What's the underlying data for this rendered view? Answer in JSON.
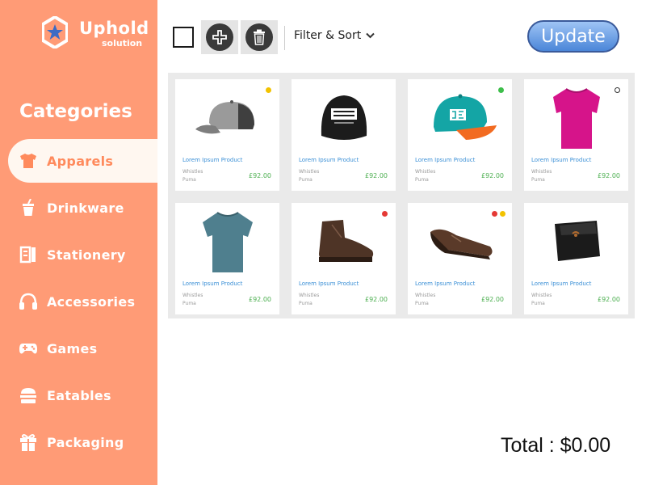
{
  "brand": {
    "name": "Uphold",
    "subtitle": "solution"
  },
  "sidebar": {
    "title": "Categories",
    "items": [
      {
        "label": "Apparels",
        "icon": "tshirt-icon",
        "selected": true
      },
      {
        "label": "Drinkware",
        "icon": "cup-icon"
      },
      {
        "label": "Stationery",
        "icon": "notebook-icon"
      },
      {
        "label": "Accessories",
        "icon": "headphones-icon"
      },
      {
        "label": "Games",
        "icon": "gamepad-icon"
      },
      {
        "label": "Eatables",
        "icon": "burger-icon"
      },
      {
        "label": "Packaging",
        "icon": "gift-icon"
      }
    ]
  },
  "toolbar": {
    "filter_label": "Filter & Sort",
    "update_label": "Update"
  },
  "products": [
    {
      "name": "Lorem Ipsum Product",
      "line1": "Whistles",
      "line2": "Puma",
      "price": "£92.00",
      "image": "grey-cap",
      "badges": [
        "#F2C200"
      ]
    },
    {
      "name": "Lorem Ipsum Product",
      "line1": "Whistles",
      "line2": "Puma",
      "price": "£92.00",
      "image": "black-cap",
      "badges": []
    },
    {
      "name": "Lorem Ipsum Product",
      "line1": "Whistles",
      "line2": "Puma",
      "price": "£92.00",
      "image": "teal-cap",
      "badges": [
        "#3DBE4A"
      ]
    },
    {
      "name": "Lorem Ipsum Product",
      "line1": "Whistles",
      "line2": "Puma",
      "price": "£92.00",
      "image": "magenta-tshirt",
      "badges": [
        "#333333"
      ]
    },
    {
      "name": "Lorem Ipsum Product",
      "line1": "Whistles",
      "line2": "Puma",
      "price": "£92.00",
      "image": "teal-tshirt",
      "badges": []
    },
    {
      "name": "Lorem Ipsum Product",
      "line1": "Whistles",
      "line2": "Puma",
      "price": "£92.00",
      "image": "brown-boot",
      "badges": [
        "#E53935"
      ]
    },
    {
      "name": "Lorem Ipsum Product",
      "line1": "Whistles",
      "line2": "Puma",
      "price": "£92.00",
      "image": "brown-shoe",
      "badges": [
        "#E53935",
        "#F2C200"
      ]
    },
    {
      "name": "Lorem Ipsum Product",
      "line1": "Whistles",
      "line2": "Puma",
      "price": "£92.00",
      "image": "black-wallet",
      "badges": []
    }
  ],
  "total_label": "Total : $0.00",
  "colors": {
    "sidebar": "#FF9B76",
    "price": "#4CAF50",
    "link": "#3A8FD6",
    "accent": "#FF8A5C"
  }
}
